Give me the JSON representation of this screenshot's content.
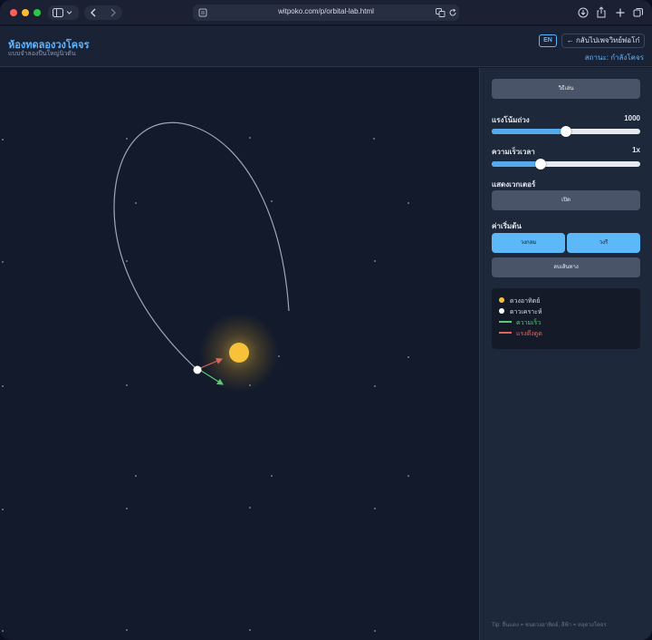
{
  "browser": {
    "url": "witpoko.com/p/orbital-lab.html"
  },
  "header": {
    "title": "ห้องทดลองวงโคจร",
    "subtitle": "แบบจำลองปืนใหญ่นิวตัน",
    "lang_label": "EN",
    "back_label": "← กลับไปเพจวิทย์พ่อโก๋",
    "status": "สถานะ: กำลังโคจร"
  },
  "panel": {
    "play_label": "วิธีเล่น",
    "gravity": {
      "label": "แรงโน้มถ่วง",
      "value": "1000",
      "level": 0.5
    },
    "time_speed": {
      "label": "ความเร็วเวลา",
      "value": "1x",
      "level": 0.33
    },
    "vectors": {
      "label": "แสดงเวกเตอร์",
      "button": "เปิด"
    },
    "presets": {
      "label": "ค่าเริ่มต้น",
      "circle": "วงกลม",
      "ellipse": "วงรี"
    },
    "clear_label": "ลบเส้นทาง"
  },
  "legend": {
    "sun": "ดวงอาทิตย์",
    "planet": "ดาวเคราะห์",
    "velocity": "ความเร็ว",
    "gravity_force": "แรงดึงดูด"
  },
  "tip": "Tip: ลื่นแดง = ชนดวงอาทิตย์, สีฟ้า = หลุดวงโคจร",
  "colors": {
    "accent": "#5fb6ff",
    "sun": "#f7c23a",
    "velocity": "#5cc878",
    "gravity": "#e0645a",
    "orbit": "#b8bfcc"
  }
}
